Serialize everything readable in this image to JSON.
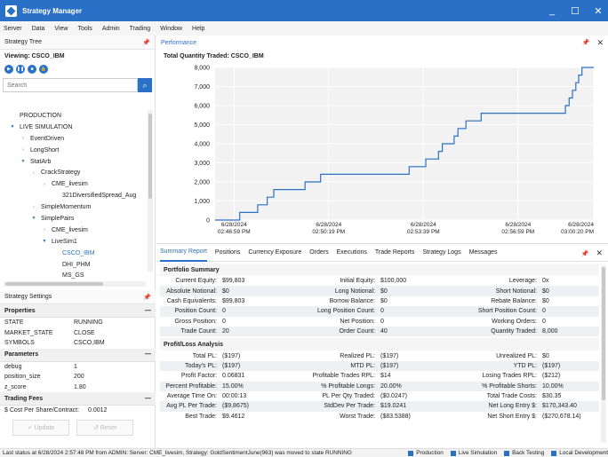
{
  "app": {
    "title": "Strategy Manager",
    "brand_color": "#2a70c6"
  },
  "window_controls": {
    "minimize": "_",
    "maximize": "☐",
    "close": "✕"
  },
  "menu": [
    "Server",
    "Data",
    "View",
    "Tools",
    "Admin",
    "Trading",
    "Window",
    "Help"
  ],
  "strategy_tree": {
    "title": "Strategy Tree",
    "viewing": "Viewing: CSCO_IBM",
    "search_placeholder": "Search",
    "items": [
      {
        "label": "PRODUCTION",
        "indent": 0,
        "arrow": ""
      },
      {
        "label": "LIVE SIMULATION",
        "indent": 0,
        "arrow": "▼"
      },
      {
        "label": "EventDriven",
        "indent": 1,
        "arrow": "›"
      },
      {
        "label": "LongShort",
        "indent": 1,
        "arrow": "›"
      },
      {
        "label": "StatArb",
        "indent": 1,
        "arrow": "▼"
      },
      {
        "label": "CrackStrategy",
        "indent": 2,
        "arrow": "›"
      },
      {
        "label": "CME_livesim",
        "indent": 3,
        "arrow": "›"
      },
      {
        "label": "321DiversifiedSpread_Aug",
        "indent": 4,
        "arrow": ""
      },
      {
        "label": "SimpleMomentum",
        "indent": 2,
        "arrow": "›"
      },
      {
        "label": "SimplePairs",
        "indent": 2,
        "arrow": "▼"
      },
      {
        "label": "CME_livesim",
        "indent": 3,
        "arrow": "›"
      },
      {
        "label": "LiveSim1",
        "indent": 3,
        "arrow": "▼"
      },
      {
        "label": "CSCO_IBM",
        "indent": 4,
        "arrow": "",
        "selected": true
      },
      {
        "label": "DHI_PHM",
        "indent": 4,
        "arrow": ""
      },
      {
        "label": "MS_GS",
        "indent": 4,
        "arrow": ""
      }
    ]
  },
  "strategy_settings": {
    "title": "Strategy Settings",
    "properties": {
      "title": "Properties",
      "rows": [
        {
          "k": "STATE",
          "v": "RUNNING"
        },
        {
          "k": "MARKET_STATE",
          "v": "CLOSE"
        },
        {
          "k": "SYMBOLS",
          "v": "CSCO,IBM"
        }
      ]
    },
    "parameters": {
      "title": "Parameters",
      "rows": [
        {
          "k": "debug",
          "v": "1"
        },
        {
          "k": "position_size",
          "v": "200"
        },
        {
          "k": "z_score",
          "v": "1.80"
        }
      ]
    },
    "trading_fees": {
      "title": "Trading Fees",
      "rows": [
        {
          "k": "$ Cost Per Share/Contract:",
          "v": "0.0012"
        }
      ]
    },
    "update_label": "✓ Update",
    "reset_label": "↺ Reset"
  },
  "performance": {
    "title": "Performance",
    "chart_title": "Total Quantity Traded: CSCO_IBM"
  },
  "chart_data": {
    "type": "line",
    "title": "Total Quantity Traded: CSCO_IBM",
    "ylim": [
      0,
      8000
    ],
    "yticks": [
      0,
      1000,
      2000,
      3000,
      4000,
      5000,
      6000,
      7000,
      8000
    ],
    "ytick_labels": [
      "0",
      "1,000",
      "2,000",
      "3,000",
      "4,000",
      "5,000",
      "6,000",
      "7,000",
      "8,000"
    ],
    "x_tick_labels": [
      [
        "6/28/2024",
        "02:46:59 PM"
      ],
      [
        "6/28/2024",
        "02:50:19 PM"
      ],
      [
        "6/28/2024",
        "02:53:39 PM"
      ],
      [
        "6/28/2024",
        "02:56:59 PM"
      ],
      [
        "6/28/2024",
        "03:00:20 PM"
      ]
    ],
    "xlim": [
      0,
      800
    ],
    "xticks": [
      40,
      240,
      440,
      640,
      800
    ],
    "series": [
      {
        "points": [
          [
            0,
            0
          ],
          [
            52,
            0
          ],
          [
            52,
            400
          ],
          [
            90,
            400
          ],
          [
            90,
            800
          ],
          [
            110,
            800
          ],
          [
            110,
            1200
          ],
          [
            124,
            1200
          ],
          [
            124,
            1600
          ],
          [
            190,
            1600
          ],
          [
            190,
            2000
          ],
          [
            223,
            2000
          ],
          [
            223,
            2400
          ],
          [
            410,
            2400
          ],
          [
            410,
            2800
          ],
          [
            445,
            2800
          ],
          [
            445,
            3200
          ],
          [
            472,
            3200
          ],
          [
            472,
            3600
          ],
          [
            480,
            3600
          ],
          [
            480,
            4000
          ],
          [
            505,
            4000
          ],
          [
            505,
            4400
          ],
          [
            513,
            4400
          ],
          [
            513,
            4800
          ],
          [
            530,
            4800
          ],
          [
            530,
            5200
          ],
          [
            562,
            5200
          ],
          [
            562,
            5600
          ],
          [
            740,
            5600
          ],
          [
            740,
            6000
          ],
          [
            748,
            6000
          ],
          [
            748,
            6400
          ],
          [
            755,
            6400
          ],
          [
            755,
            6800
          ],
          [
            762,
            6800
          ],
          [
            762,
            7200
          ],
          [
            768,
            7200
          ],
          [
            768,
            7600
          ],
          [
            775,
            7600
          ],
          [
            775,
            8000
          ],
          [
            800,
            8000
          ]
        ]
      }
    ],
    "grid": true
  },
  "bottom_tabs": [
    "Summary Report",
    "Positions",
    "Currency Exposure",
    "Orders",
    "Executions",
    "Trade Reports",
    "Strategy Logs",
    "Messages"
  ],
  "portfolio_summary": {
    "title": "Portfolio Summary",
    "rows": [
      [
        [
          "Current Equity:",
          "$99,803"
        ],
        [
          "Initial Equity:",
          "$100,000"
        ],
        [
          "Leverage:",
          "0x"
        ]
      ],
      [
        [
          "Absolute Notional:",
          "$0"
        ],
        [
          "Long Notional:",
          "$0"
        ],
        [
          "Short Notional:",
          "$0"
        ]
      ],
      [
        [
          "Cash Equivalents:",
          "$99,803"
        ],
        [
          "Borrow Balance:",
          "$0"
        ],
        [
          "Rebate Balance:",
          "$0"
        ]
      ],
      [
        [
          "Position Count:",
          "0"
        ],
        [
          "Long Position Count:",
          "0"
        ],
        [
          "Short Position Count:",
          "0"
        ]
      ],
      [
        [
          "Gross Position:",
          "0"
        ],
        [
          "Net Position:",
          "0"
        ],
        [
          "Working Orders:",
          "0"
        ]
      ],
      [
        [
          "Trade Count:",
          "20"
        ],
        [
          "Order Count:",
          "40"
        ],
        [
          "Quantity Traded:",
          "8,000"
        ]
      ]
    ]
  },
  "profit_loss": {
    "title": "Profit/Loss Analysis",
    "rows": [
      [
        [
          "Total PL:",
          "($197)"
        ],
        [
          "Realized PL:",
          "($197)"
        ],
        [
          "Unrealized PL:",
          "$0"
        ]
      ],
      [
        [
          "Today's PL:",
          "($197)"
        ],
        [
          "MTD PL:",
          "($197)"
        ],
        [
          "YTD PL:",
          "($197)"
        ]
      ],
      [
        [
          "Profit Factor:",
          "0.06831"
        ],
        [
          "Profitable Trades RPL:",
          "$14"
        ],
        [
          "Losing Trades RPL:",
          "($212)"
        ]
      ],
      [
        [
          "Percent Profitable:",
          "15.00%"
        ],
        [
          "% Profitable Longs:",
          "20.00%"
        ],
        [
          "% Profitable Shorts:",
          "10.00%"
        ]
      ],
      [
        [
          "Average Time On:",
          "00:00:13"
        ],
        [
          "PL Per Qty Traded:",
          "($0.0247)"
        ],
        [
          "Total Trade Costs:",
          "$30.35"
        ]
      ],
      [
        [
          "Avg PL Per Trade:",
          "($9.8675)"
        ],
        [
          "StdDev Per Trade:",
          "$19.0241"
        ],
        [
          "Net Long Entry $:",
          "$170,343.40"
        ]
      ],
      [
        [
          "Best Trade:",
          "$9.4612"
        ],
        [
          "Worst Trade:",
          "($83.5388)"
        ],
        [
          "Net Short Entry $:",
          "($270,678.14)"
        ]
      ]
    ]
  },
  "status_bar": {
    "message": "Last status at 6/28/2024 2:57:48 PM from ADMIN: Server: CME_livesim, Strategy: GoldSentimentJune(963) was moved to state RUNNING",
    "modes": [
      "Production",
      "Live Simulation",
      "Back Testing",
      "Local Development"
    ]
  }
}
